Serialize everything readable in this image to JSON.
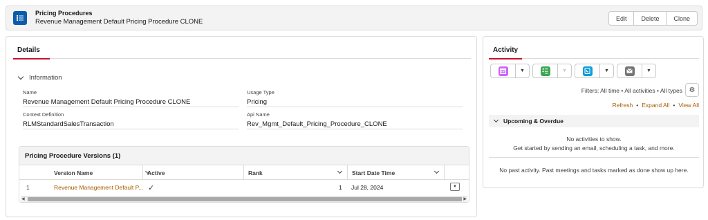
{
  "header": {
    "object_type": "Pricing Procedures",
    "record_name": "Revenue Management Default Pricing Procedure CLONE",
    "icon": "list-icon",
    "icon_color": "#0b5cab",
    "buttons": {
      "edit": "Edit",
      "delete": "Delete",
      "clone": "Clone"
    }
  },
  "details": {
    "tab_label": "Details",
    "section_label": "Information",
    "fields": {
      "name": {
        "label": "Name",
        "value": "Revenue Management Default Pricing Procedure CLONE"
      },
      "usage_type": {
        "label": "Usage Type",
        "value": "Pricing"
      },
      "context_definition": {
        "label": "Context Definition",
        "value": "RLMStandardSalesTransaction"
      },
      "api_name": {
        "label": "Api Name",
        "value": "Rev_Mgmt_Default_Pricing_Procedure_CLONE"
      }
    },
    "related_list": {
      "title": "Pricing Procedure Versions (1)",
      "columns": {
        "version_name": "Version Name",
        "active": "Active",
        "rank": "Rank",
        "start_date_time": "Start Date Time"
      },
      "rows": [
        {
          "num": "1",
          "version_name": "Revenue Management Default P...",
          "active": "✓",
          "rank": "1",
          "start_date_time": "Jul 28, 2024"
        }
      ]
    }
  },
  "activity": {
    "tab_label": "Activity",
    "action_icons": [
      {
        "name": "event-icon",
        "color": "#cb65ff"
      },
      {
        "name": "task-icon",
        "color": "#3ba755"
      },
      {
        "name": "log-call-icon",
        "color": "#0d9dda"
      },
      {
        "name": "email-icon",
        "color": "#747474"
      }
    ],
    "filters": "Filters: All time • All activities • All types",
    "refresh": "Refresh",
    "expand_all": "Expand All",
    "view_all": "View All",
    "sep": "•",
    "upcoming_label": "Upcoming & Overdue",
    "no_activities": "No activities to show.",
    "get_started": "Get started by sending an email, scheduling a task, and more.",
    "no_past": "No past activity. Past meetings and tasks marked as done show up here."
  },
  "colors": {
    "accent": "#c8102e",
    "link": "#a85d00",
    "border": "#dddbda"
  }
}
